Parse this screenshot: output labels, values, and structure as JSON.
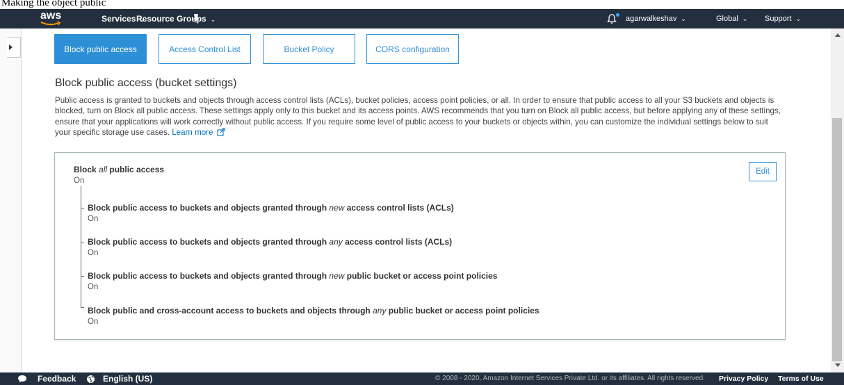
{
  "caption": "Making the object public",
  "navbar": {
    "logo": "aws",
    "services": "Services",
    "resource_groups": "Resource Groups",
    "user": "agarwalkeshav",
    "region": "Global",
    "support": "Support",
    "brand_color": "#232f3e",
    "accent_color": "#ff9900"
  },
  "tabs": [
    {
      "label": "Block public access",
      "active": true
    },
    {
      "label": "Access Control List",
      "active": false
    },
    {
      "label": "Bucket Policy",
      "active": false
    },
    {
      "label": "CORS configuration",
      "active": false
    }
  ],
  "section": {
    "title": "Block public access (bucket settings)",
    "description": "Public access is granted to buckets and objects through access control lists (ACLs), bucket policies, access point policies, or all. In order to ensure that public access to all your S3 buckets and objects is blocked, turn on Block all public access. These settings apply only to this bucket and its access points. AWS recommends that you turn on Block all public access, but before applying any of these settings, ensure that your applications will work correctly without public access. If you require some level of public access to your buckets or objects within, you can customize the individual settings below to suit your specific storage use cases.",
    "learn_more": "Learn more"
  },
  "panel": {
    "edit_label": "Edit",
    "main_setting": {
      "title_pre": "Block ",
      "title_em": "all",
      "title_post": " public access",
      "value": "On"
    },
    "settings": [
      {
        "pre": "Block public access to buckets and objects granted through ",
        "em": "new",
        "post": " access control lists (ACLs)",
        "value": "On"
      },
      {
        "pre": "Block public access to buckets and objects granted through ",
        "em": "any",
        "post": " access control lists (ACLs)",
        "value": "On"
      },
      {
        "pre": "Block public access to buckets and objects granted through ",
        "em": "new",
        "post": " public bucket or access point policies",
        "value": "On"
      },
      {
        "pre": "Block public and cross-account access to buckets and objects through ",
        "em": "any",
        "post": " public bucket or access point policies",
        "value": "On"
      }
    ]
  },
  "footer": {
    "feedback": "Feedback",
    "language": "English (US)",
    "copyright": "© 2008 - 2020, Amazon Internet Services Private Ltd. or its affiliates. All rights reserved.",
    "privacy": "Privacy Policy",
    "terms": "Terms of Use"
  },
  "icons": {
    "pin": "pin-icon",
    "bell": "bell-icon",
    "external_link": "external-link-icon",
    "feedback": "chat-bubble-icon",
    "language": "globe-icon"
  }
}
